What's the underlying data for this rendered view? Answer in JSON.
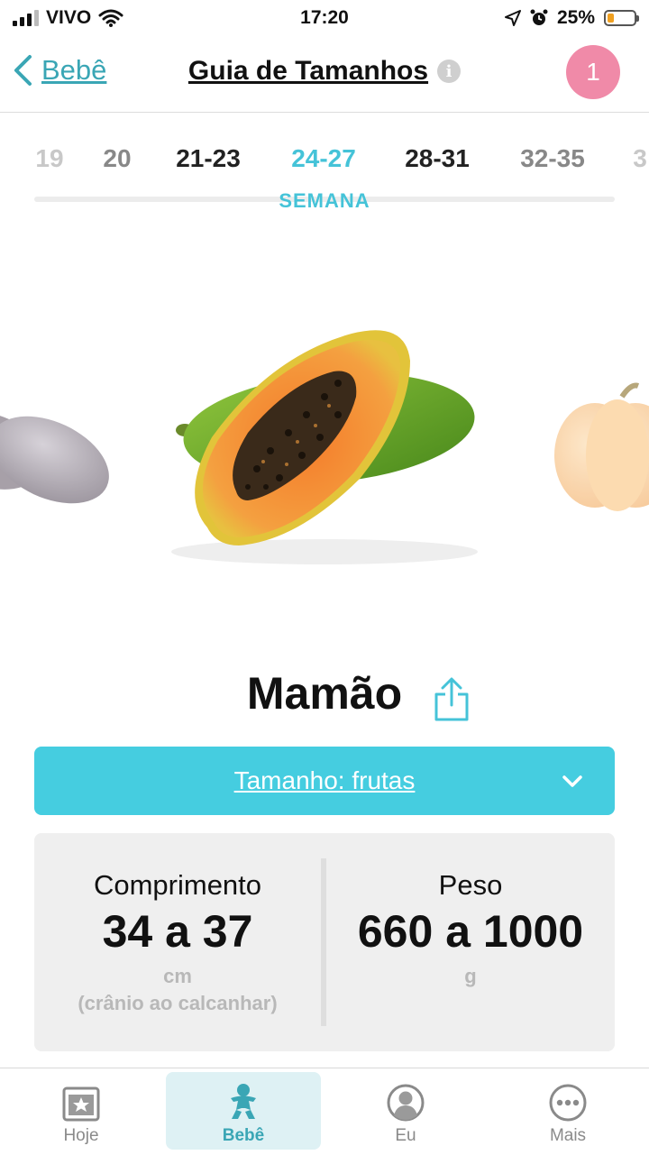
{
  "status_bar": {
    "carrier": "VIVO",
    "time": "17:20",
    "battery_percent": "25%",
    "battery_level": 0.25,
    "icons": [
      "signal-icon",
      "wifi-icon",
      "location-arrow-icon",
      "alarm-icon",
      "battery-icon"
    ]
  },
  "nav": {
    "back_label": "Bebê",
    "title": "Guia de Tamanhos",
    "info_symbol": "i",
    "notification_count": "1"
  },
  "weeks": {
    "items": [
      "19",
      "20",
      "21-23",
      "24-27",
      "28-31",
      "32-35",
      "3"
    ],
    "selected": "24-27",
    "unit_label": "SEMANA"
  },
  "carousel": {
    "previous_fruit_icon": "eggplant-icon",
    "current_fruit_icon": "papaya-icon",
    "next_fruit_icon": "pumpkin-icon"
  },
  "fruit": {
    "name": "Mamão",
    "share_icon": "share-icon"
  },
  "size_dropdown": {
    "label": "Tamanho: frutas"
  },
  "stats": {
    "length_label": "Comprimento",
    "length_value": "34 a 37",
    "length_unit": "cm",
    "length_note": "(crânio ao calcanhar)",
    "weight_label": "Peso",
    "weight_value": "660 a 1000",
    "weight_unit": "g"
  },
  "tabs": [
    {
      "label": "Hoje",
      "icon": "calendar-star-icon"
    },
    {
      "label": "Bebê",
      "icon": "baby-icon",
      "active": true
    },
    {
      "label": "Eu",
      "icon": "user-avatar-icon"
    },
    {
      "label": "Mais",
      "icon": "more-icon"
    }
  ],
  "colors": {
    "accent": "#45c3d8",
    "dropdown_bg": "#45cde0",
    "badge": "#f08aa8",
    "active_tab_bg": "#def1f4",
    "card_bg": "#efefef"
  }
}
